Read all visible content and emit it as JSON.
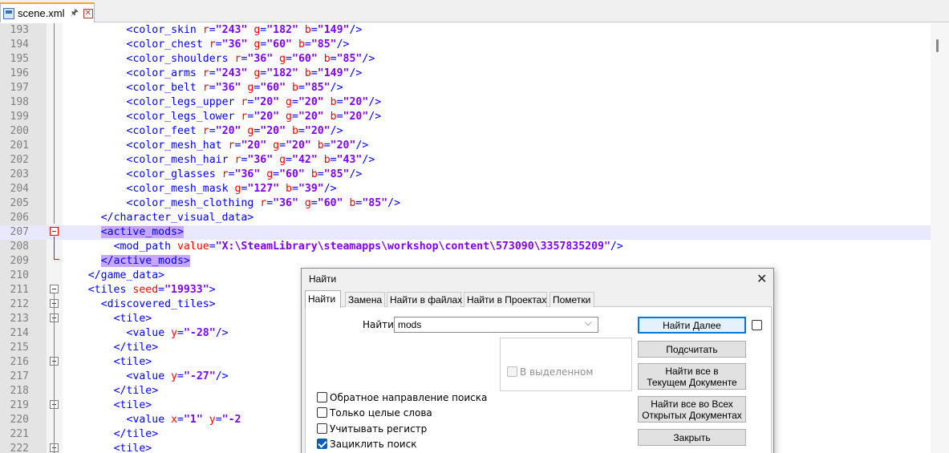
{
  "tab": {
    "title": "scene.xml",
    "pin_icon": "pin-icon",
    "close_icon": "close-icon"
  },
  "editor": {
    "lines": [
      {
        "n": "193",
        "code": [
          [
            "tg",
            "<color_skin "
          ],
          [
            "at",
            "r"
          ],
          [
            "eq",
            "="
          ],
          [
            "vl",
            "\"243\""
          ],
          [
            "at",
            " g"
          ],
          [
            "eq",
            "="
          ],
          [
            "vl",
            "\"182\""
          ],
          [
            "at",
            " b"
          ],
          [
            "eq",
            "="
          ],
          [
            "vl",
            "\"149\""
          ],
          [
            "tg",
            "/>"
          ]
        ]
      },
      {
        "n": "194",
        "code": [
          [
            "tg",
            "<color_chest "
          ],
          [
            "at",
            "r"
          ],
          [
            "eq",
            "="
          ],
          [
            "vl",
            "\"36\""
          ],
          [
            "at",
            " g"
          ],
          [
            "eq",
            "="
          ],
          [
            "vl",
            "\"60\""
          ],
          [
            "at",
            " b"
          ],
          [
            "eq",
            "="
          ],
          [
            "vl",
            "\"85\""
          ],
          [
            "tg",
            "/>"
          ]
        ]
      },
      {
        "n": "195",
        "code": [
          [
            "tg",
            "<color_shoulders "
          ],
          [
            "at",
            "r"
          ],
          [
            "eq",
            "="
          ],
          [
            "vl",
            "\"36\""
          ],
          [
            "at",
            " g"
          ],
          [
            "eq",
            "="
          ],
          [
            "vl",
            "\"60\""
          ],
          [
            "at",
            " b"
          ],
          [
            "eq",
            "="
          ],
          [
            "vl",
            "\"85\""
          ],
          [
            "tg",
            "/>"
          ]
        ]
      },
      {
        "n": "196",
        "code": [
          [
            "tg",
            "<color_arms "
          ],
          [
            "at",
            "r"
          ],
          [
            "eq",
            "="
          ],
          [
            "vl",
            "\"243\""
          ],
          [
            "at",
            " g"
          ],
          [
            "eq",
            "="
          ],
          [
            "vl",
            "\"182\""
          ],
          [
            "at",
            " b"
          ],
          [
            "eq",
            "="
          ],
          [
            "vl",
            "\"149\""
          ],
          [
            "tg",
            "/>"
          ]
        ]
      },
      {
        "n": "197",
        "code": [
          [
            "tg",
            "<color_belt "
          ],
          [
            "at",
            "r"
          ],
          [
            "eq",
            "="
          ],
          [
            "vl",
            "\"36\""
          ],
          [
            "at",
            " g"
          ],
          [
            "eq",
            "="
          ],
          [
            "vl",
            "\"60\""
          ],
          [
            "at",
            " b"
          ],
          [
            "eq",
            "="
          ],
          [
            "vl",
            "\"85\""
          ],
          [
            "tg",
            "/>"
          ]
        ]
      },
      {
        "n": "198",
        "code": [
          [
            "tg",
            "<color_legs_upper "
          ],
          [
            "at",
            "r"
          ],
          [
            "eq",
            "="
          ],
          [
            "vl",
            "\"20\""
          ],
          [
            "at",
            " g"
          ],
          [
            "eq",
            "="
          ],
          [
            "vl",
            "\"20\""
          ],
          [
            "at",
            " b"
          ],
          [
            "eq",
            "="
          ],
          [
            "vl",
            "\"20\""
          ],
          [
            "tg",
            "/>"
          ]
        ]
      },
      {
        "n": "199",
        "code": [
          [
            "tg",
            "<color_legs_lower "
          ],
          [
            "at",
            "r"
          ],
          [
            "eq",
            "="
          ],
          [
            "vl",
            "\"20\""
          ],
          [
            "at",
            " g"
          ],
          [
            "eq",
            "="
          ],
          [
            "vl",
            "\"20\""
          ],
          [
            "at",
            " b"
          ],
          [
            "eq",
            "="
          ],
          [
            "vl",
            "\"20\""
          ],
          [
            "tg",
            "/>"
          ]
        ]
      },
      {
        "n": "200",
        "code": [
          [
            "tg",
            "<color_feet "
          ],
          [
            "at",
            "r"
          ],
          [
            "eq",
            "="
          ],
          [
            "vl",
            "\"20\""
          ],
          [
            "at",
            " g"
          ],
          [
            "eq",
            "="
          ],
          [
            "vl",
            "\"20\""
          ],
          [
            "at",
            " b"
          ],
          [
            "eq",
            "="
          ],
          [
            "vl",
            "\"20\""
          ],
          [
            "tg",
            "/>"
          ]
        ]
      },
      {
        "n": "201",
        "code": [
          [
            "tg",
            "<color_mesh_hat "
          ],
          [
            "at",
            "r"
          ],
          [
            "eq",
            "="
          ],
          [
            "vl",
            "\"20\""
          ],
          [
            "at",
            " g"
          ],
          [
            "eq",
            "="
          ],
          [
            "vl",
            "\"20\""
          ],
          [
            "at",
            " b"
          ],
          [
            "eq",
            "="
          ],
          [
            "vl",
            "\"20\""
          ],
          [
            "tg",
            "/>"
          ]
        ]
      },
      {
        "n": "202",
        "code": [
          [
            "tg",
            "<color_mesh_hair "
          ],
          [
            "at",
            "r"
          ],
          [
            "eq",
            "="
          ],
          [
            "vl",
            "\"36\""
          ],
          [
            "at",
            " g"
          ],
          [
            "eq",
            "="
          ],
          [
            "vl",
            "\"42\""
          ],
          [
            "at",
            " b"
          ],
          [
            "eq",
            "="
          ],
          [
            "vl",
            "\"43\""
          ],
          [
            "tg",
            "/>"
          ]
        ]
      },
      {
        "n": "203",
        "code": [
          [
            "tg",
            "<color_glasses "
          ],
          [
            "at",
            "r"
          ],
          [
            "eq",
            "="
          ],
          [
            "vl",
            "\"36\""
          ],
          [
            "at",
            " g"
          ],
          [
            "eq",
            "="
          ],
          [
            "vl",
            "\"60\""
          ],
          [
            "at",
            " b"
          ],
          [
            "eq",
            "="
          ],
          [
            "vl",
            "\"85\""
          ],
          [
            "tg",
            "/>"
          ]
        ]
      },
      {
        "n": "204",
        "code": [
          [
            "tg",
            "<color_mesh_mask "
          ],
          [
            "at",
            "g"
          ],
          [
            "eq",
            "="
          ],
          [
            "vl",
            "\"127\""
          ],
          [
            "at",
            " b"
          ],
          [
            "eq",
            "="
          ],
          [
            "vl",
            "\"39\""
          ],
          [
            "tg",
            "/>"
          ]
        ]
      },
      {
        "n": "205",
        "code": [
          [
            "tg",
            "<color_mesh_clothing "
          ],
          [
            "at",
            "r"
          ],
          [
            "eq",
            "="
          ],
          [
            "vl",
            "\"36\""
          ],
          [
            "at",
            " g"
          ],
          [
            "eq",
            "="
          ],
          [
            "vl",
            "\"60\""
          ],
          [
            "at",
            " b"
          ],
          [
            "eq",
            "="
          ],
          [
            "vl",
            "\"85\""
          ],
          [
            "tg",
            "/>"
          ]
        ]
      },
      {
        "n": "206",
        "code": [
          [
            "tg",
            "</character_visual_data>"
          ]
        ]
      },
      {
        "n": "207",
        "code": [
          [
            "tg match",
            "<active_mods>"
          ]
        ]
      },
      {
        "n": "208",
        "code": [
          [
            "tg",
            "<mod_path "
          ],
          [
            "at",
            "value"
          ],
          [
            "eq",
            "="
          ],
          [
            "vl",
            "\"X:\\SteamLibrary\\steamapps\\workshop\\content\\573090\\3357835209\""
          ],
          [
            "tg",
            "/>"
          ]
        ]
      },
      {
        "n": "209",
        "code": [
          [
            "tg match",
            "</active_mods>"
          ]
        ]
      },
      {
        "n": "210",
        "code": [
          [
            "tg",
            "</game_data>"
          ]
        ]
      },
      {
        "n": "211",
        "code": [
          [
            "tg",
            "<tiles "
          ],
          [
            "at",
            "seed"
          ],
          [
            "eq",
            "="
          ],
          [
            "vl",
            "\"19933\""
          ],
          [
            "tg",
            ">"
          ]
        ]
      },
      {
        "n": "212",
        "code": [
          [
            "tg",
            "<discovered_tiles>"
          ]
        ]
      },
      {
        "n": "213",
        "code": [
          [
            "tg",
            "<tile>"
          ]
        ]
      },
      {
        "n": "214",
        "code": [
          [
            "tg",
            "<value "
          ],
          [
            "at",
            "y"
          ],
          [
            "eq",
            "="
          ],
          [
            "vl",
            "\"-28\""
          ],
          [
            "tg",
            "/>"
          ]
        ]
      },
      {
        "n": "215",
        "code": [
          [
            "tg",
            "</tile>"
          ]
        ]
      },
      {
        "n": "216",
        "code": [
          [
            "tg",
            "<tile>"
          ]
        ]
      },
      {
        "n": "217",
        "code": [
          [
            "tg",
            "<value "
          ],
          [
            "at",
            "y"
          ],
          [
            "eq",
            "="
          ],
          [
            "vl",
            "\"-27\""
          ],
          [
            "tg",
            "/>"
          ]
        ]
      },
      {
        "n": "218",
        "code": [
          [
            "tg",
            "</tile>"
          ]
        ]
      },
      {
        "n": "219",
        "code": [
          [
            "tg",
            "<tile>"
          ]
        ]
      },
      {
        "n": "220",
        "code": [
          [
            "tg",
            "<value "
          ],
          [
            "at",
            "x"
          ],
          [
            "eq",
            "="
          ],
          [
            "vl",
            "\"1\""
          ],
          [
            "at",
            " y"
          ],
          [
            "eq",
            "="
          ],
          [
            "vl",
            "\"-2"
          ]
        ]
      },
      {
        "n": "221",
        "code": [
          [
            "tg",
            "</tile>"
          ]
        ]
      },
      {
        "n": "222",
        "code": [
          [
            "tg",
            "<tile>"
          ]
        ]
      }
    ]
  },
  "find_dialog": {
    "title": "Найти",
    "close_icon": "close-icon",
    "tabs": [
      "Найти",
      "Замена",
      "Найти в файлах",
      "Найти в Проектах",
      "Пометки"
    ],
    "find_label": "Найти:",
    "find_value": "mods",
    "buttons": {
      "find_next": "Найти Далее",
      "count": "Подсчитать",
      "find_all_current_1": "Найти все в",
      "find_all_current_2": "Текущем Документе",
      "find_all_open_1": "Найти все во Всех",
      "find_all_open_2": "Открытых Документах",
      "close": "Закрыть"
    },
    "in_selection": "В выделенном",
    "options": {
      "backward": "Обратное направление поиска",
      "whole_word": "Только целые слова",
      "match_case": "Учитывать регистр",
      "wrap": "Зациклить поиск"
    },
    "checked": {
      "backward": false,
      "whole_word": false,
      "match_case": false,
      "wrap": true,
      "in_selection": false
    }
  }
}
